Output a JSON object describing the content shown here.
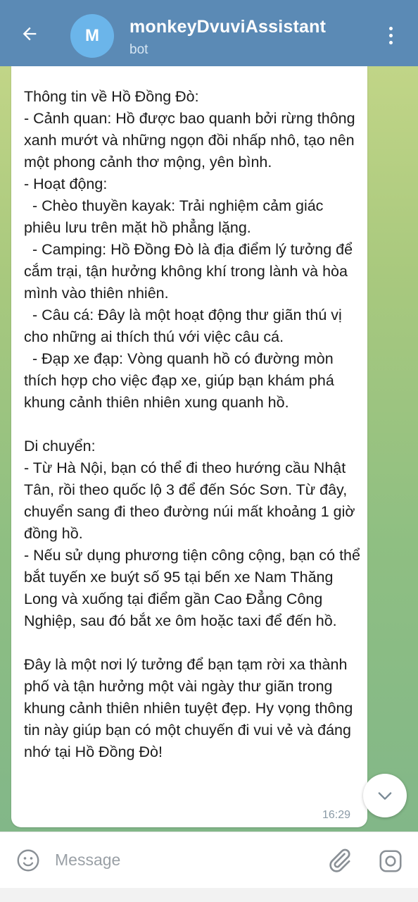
{
  "header": {
    "avatar_letter": "M",
    "title": "monkeyDvuviAssistant",
    "subtitle": "bot",
    "back_icon": "arrow-left-icon",
    "menu_icon": "more-vertical-icon"
  },
  "message": {
    "text": "Thông tin về Hồ Đồng Đò:\n- Cảnh quan: Hồ được bao quanh bởi rừng thông xanh mướt và những ngọn đồi nhấp nhô, tạo nên một phong cảnh thơ mộng, yên bình.\n- Hoạt động:\n  - Chèo thuyền kayak: Trải nghiệm cảm giác phiêu lưu trên mặt hồ phẳng lặng.\n  - Camping: Hồ Đồng Đò là địa điểm lý tưởng để cắm trại, tận hưởng không khí trong lành và hòa mình vào thiên nhiên.\n  - Câu cá: Đây là một hoạt động thư giãn thú vị cho những ai thích thú với việc câu cá.\n  - Đạp xe đạp: Vòng quanh hồ có đường mòn thích hợp cho việc đạp xe, giúp bạn khám phá khung cảnh thiên nhiên xung quanh hồ.\n\nDi chuyển:\n- Từ Hà Nội, bạn có thể đi theo hướng cầu Nhật Tân, rồi theo quốc lộ 3 để đến Sóc Sơn. Từ đây, chuyển sang đi theo đường núi mất khoảng 1 giờ đồng hồ.\n- Nếu sử dụng phương tiện công cộng, bạn có thể bắt tuyến xe buýt số 95 tại bến xe Nam Thăng Long và xuống tại điểm gần Cao Đẳng Công Nghiệp, sau đó bắt xe ôm hoặc taxi để đến hồ.\n\nĐây là một nơi lý tưởng để bạn tạm rời xa thành phố và tận hưởng một vài ngày thư giãn trong khung cảnh thiên nhiên tuyệt đẹp. Hy vọng thông tin này giúp bạn có một chuyến đi vui vẻ và đáng nhớ tại Hồ Đồng Đò!",
    "time": "16:29"
  },
  "input": {
    "placeholder": "Message",
    "emoji_icon": "smile-icon",
    "attach_icon": "paperclip-icon",
    "camera_icon": "camera-icon"
  },
  "colors": {
    "header_bg": "#5b8ab5",
    "avatar_bg": "#6bb5ea",
    "bubble_bg": "#ffffff",
    "time_text": "#8a9aa6"
  }
}
